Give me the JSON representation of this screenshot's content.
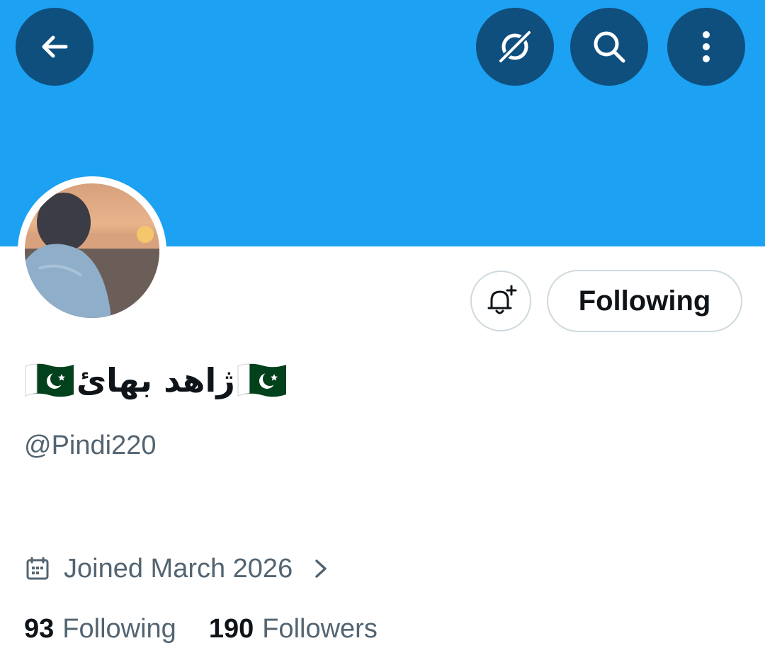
{
  "header": {
    "back_icon": "arrow-left-icon",
    "grok_icon": "grok-icon",
    "search_icon": "search-icon",
    "more_icon": "more-vertical-icon",
    "banner_color": "#1da1f2",
    "button_color": "#0f4f7e"
  },
  "profile": {
    "display_name": "ژاهد بھائ",
    "flag_icon": "pakistan-flag-icon",
    "handle": "@Pindi220",
    "joined": "Joined March 2026",
    "following_count": "93",
    "following_label": "Following",
    "followers_count": "190",
    "followers_label": "Followers"
  },
  "actions": {
    "notify_icon": "bell-plus-icon",
    "following_button": "Following"
  },
  "colors": {
    "text_primary": "#0f1419",
    "text_secondary": "#536471",
    "border": "#cfd9de"
  }
}
